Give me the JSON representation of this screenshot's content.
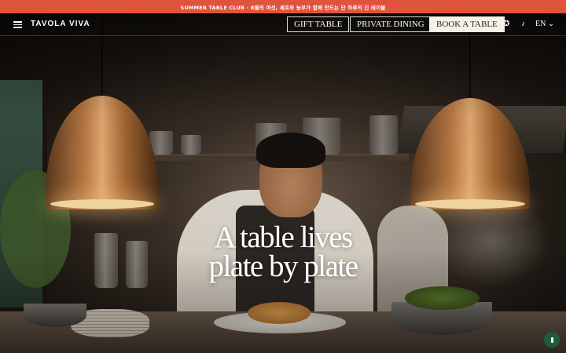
{
  "promo": {
    "text": "SUMMER TABLE CLUB · 8월의 여섯, 셰프와 농부가 함께 만드는 단 하루의 긴 테이블"
  },
  "header": {
    "brand": "TAVOLA VIVA",
    "links": [
      "GIFT TABLE",
      "PRIVATE DINING"
    ],
    "cta": "BOOK A TABLE",
    "icons": [
      "menu-icon",
      "globe-icon",
      "music-icon"
    ],
    "language": "EN ⌄"
  },
  "hero": {
    "headline_line1": "A table lives",
    "headline_line2": "plate by plate"
  },
  "colors": {
    "promo_bg": "#e0543c",
    "cta_bg": "#f6f1e8",
    "fab_bg": "#1f5a3c"
  }
}
